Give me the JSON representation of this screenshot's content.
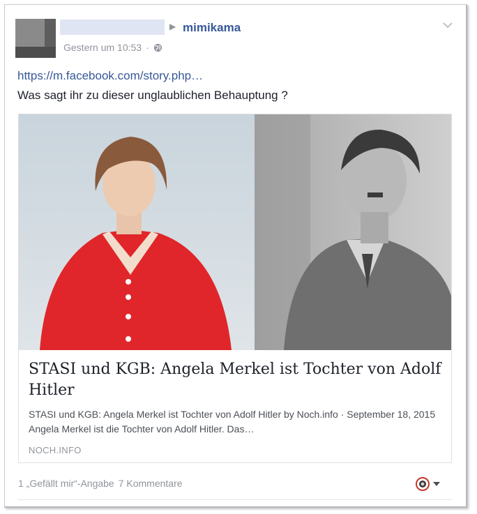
{
  "post": {
    "author_redacted": "",
    "page_name": "mimikama",
    "timestamp": "Gestern um 10:53",
    "meta_separator": "·",
    "privacy_icon": "globe-icon",
    "menu_icon": "chevron-down-icon",
    "link_text": "https://m.facebook.com/story.php…",
    "caption": "Was sagt ihr zu dieser unglaublichen Behauptung ?"
  },
  "card": {
    "title": "STASI und KGB: Angela Merkel ist Tochter von Adolf Hitler",
    "description": "STASI und KGB: Angela Merkel ist Tochter von Adolf Hitler by Noch.info · September 18, 2015 Angela Merkel ist die Tochter von Adolf Hitler. Das…",
    "domain": "NOCH.INFO"
  },
  "footer": {
    "likes": "1 „Gefällt mir“-Angabe",
    "comments": "7 Kommentare",
    "reaction_icon": "page-avatar-icon",
    "dropdown_icon": "caret-down-icon"
  },
  "colors": {
    "link": "#365899",
    "meta": "#90949c",
    "text": "#1d2129"
  }
}
